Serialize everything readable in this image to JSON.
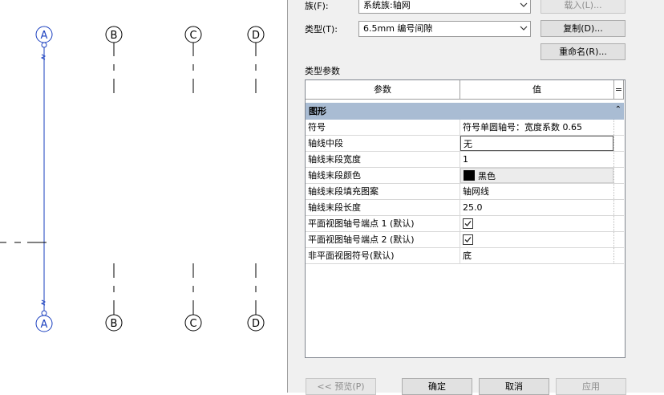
{
  "grid_view": {
    "line_color": "#1a3fbf",
    "bubbles_top": [
      "A",
      "B",
      "C",
      "D"
    ],
    "bubbles_bottom": [
      "A",
      "B",
      "C",
      "D"
    ]
  },
  "dialog": {
    "family_label": "族(F):",
    "family_value": "系统族:轴网",
    "load_button": "载入(L)...",
    "type_label": "类型(T):",
    "type_value": "6.5mm 编号间隙",
    "duplicate_button": "复制(D)...",
    "rename_button": "重命名(R)...",
    "type_params_label": "类型参数",
    "table": {
      "col_param": "参数",
      "col_value": "值",
      "col_eq": "=",
      "group": "图形",
      "collapse_glyph": "⌃",
      "rows": [
        {
          "name": "符号",
          "value": "符号单圆轴号：宽度系数 0.65"
        },
        {
          "name": "轴线中段",
          "value": "无"
        },
        {
          "name": "轴线末段宽度",
          "value": "1"
        },
        {
          "name": "轴线末段颜色",
          "value": "黑色",
          "swatch": "#000000"
        },
        {
          "name": "轴线末段填充图案",
          "value": "轴网线"
        },
        {
          "name": "轴线末段长度",
          "value": "25.0"
        },
        {
          "name": "平面视图轴号端点 1 (默认)",
          "checked": true
        },
        {
          "name": "平面视图轴号端点 2 (默认)",
          "checked": true
        },
        {
          "name": "非平面视图符号(默认)",
          "value": "底"
        }
      ]
    },
    "preview_button": "<< 预览(P)",
    "ok_button": "确定",
    "cancel_button": "取消",
    "apply_button": "应用"
  }
}
